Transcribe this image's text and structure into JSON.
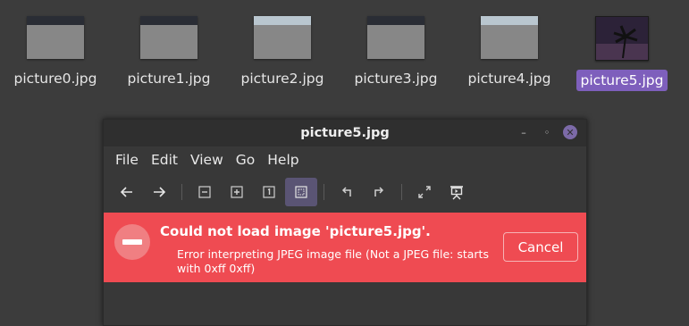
{
  "files": [
    {
      "name": "picture0.jpg",
      "selected": false
    },
    {
      "name": "picture1.jpg",
      "selected": false
    },
    {
      "name": "picture2.jpg",
      "selected": false
    },
    {
      "name": "picture3.jpg",
      "selected": false
    },
    {
      "name": "picture4.jpg",
      "selected": false
    },
    {
      "name": "picture5.jpg",
      "selected": true
    }
  ],
  "window": {
    "title": "picture5.jpg",
    "controls": {
      "minimize": "–",
      "restore": "◦",
      "close": "✕"
    }
  },
  "menu": [
    "File",
    "Edit",
    "View",
    "Go",
    "Help"
  ],
  "toolbar": {
    "buttons": [
      {
        "icon": "back-arrow-icon"
      },
      {
        "icon": "forward-arrow-icon"
      },
      {
        "icon": "zoom-out-icon"
      },
      {
        "icon": "zoom-in-icon"
      },
      {
        "icon": "zoom-normal-icon"
      },
      {
        "icon": "zoom-fit-icon",
        "active": true
      },
      {
        "icon": "rotate-left-icon"
      },
      {
        "icon": "rotate-right-icon"
      },
      {
        "icon": "fullscreen-icon"
      },
      {
        "icon": "slideshow-icon"
      }
    ]
  },
  "error": {
    "title": "Could not load image 'picture5.jpg'.",
    "message": "Error interpreting JPEG image file (Not a JPEG file: starts with 0xff 0xff)",
    "cancel_label": "Cancel"
  },
  "colors": {
    "selection": "#7e5fbc",
    "error_bar": "#ef4b52",
    "close_button": "#7c6aa8"
  }
}
